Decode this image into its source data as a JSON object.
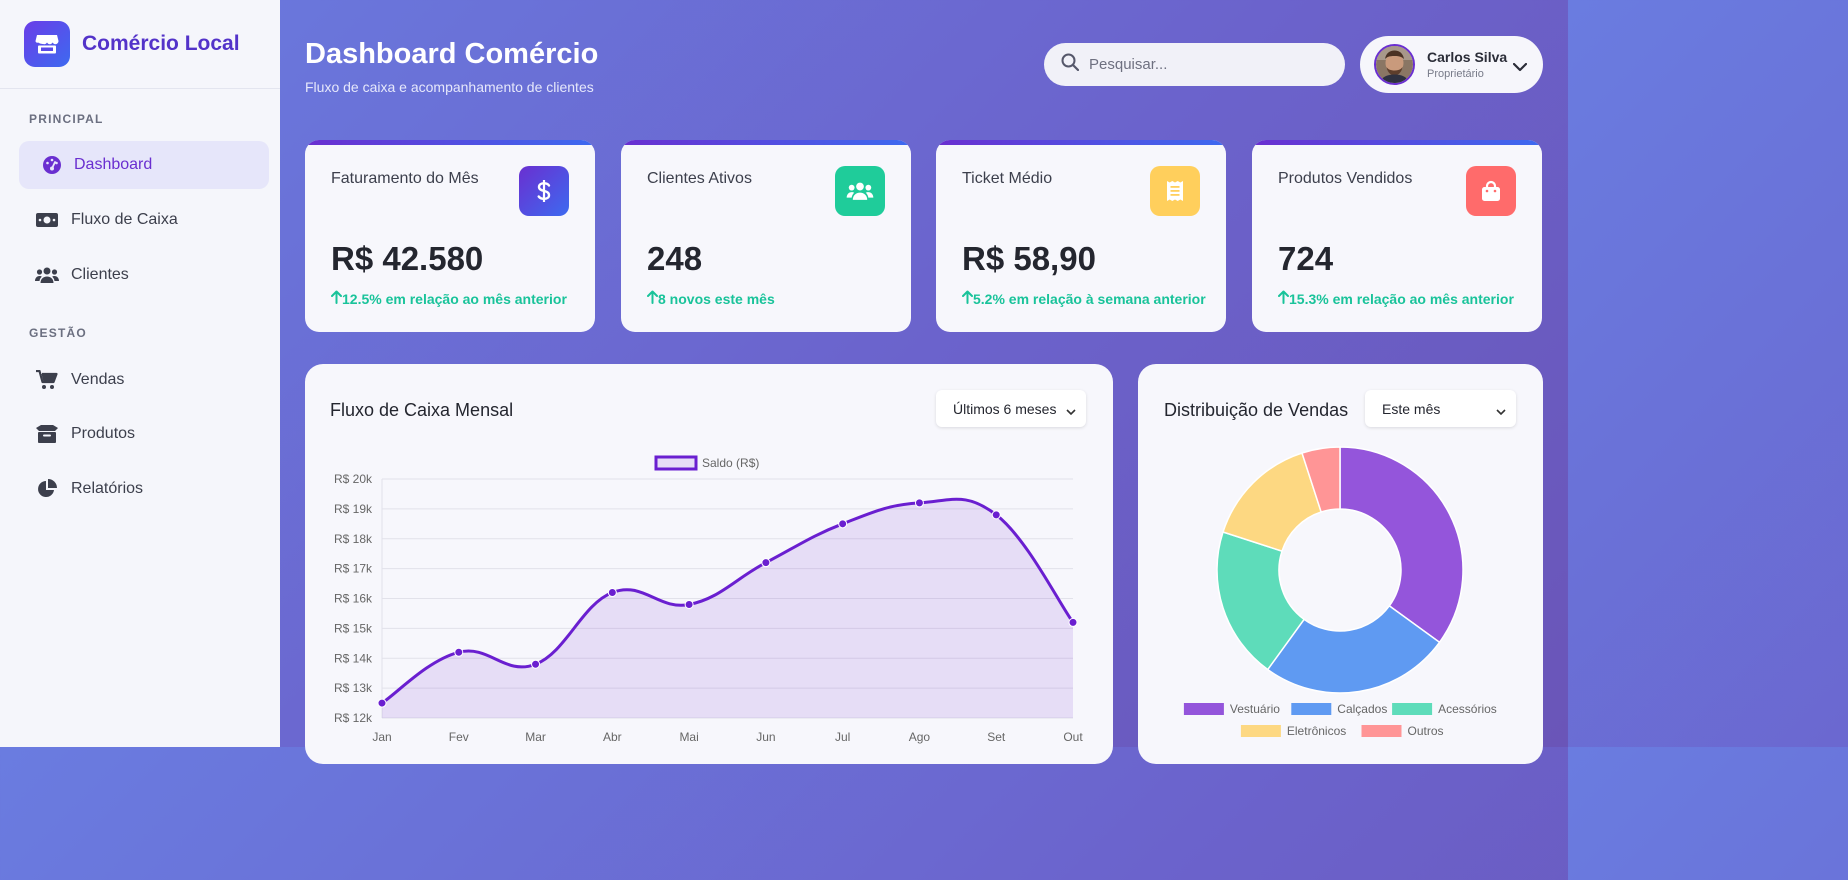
{
  "brand": {
    "name": "Comércio Local"
  },
  "sidebar": {
    "sections": [
      {
        "title": "PRINCIPAL"
      },
      {
        "title": "GESTÃO"
      }
    ],
    "items": [
      {
        "label": "Dashboard",
        "icon": "gauge-icon"
      },
      {
        "label": "Fluxo de Caixa",
        "icon": "money-bill-icon"
      },
      {
        "label": "Clientes",
        "icon": "users-icon"
      },
      {
        "label": "Vendas",
        "icon": "cart-icon"
      },
      {
        "label": "Produtos",
        "icon": "box-icon"
      },
      {
        "label": "Relatórios",
        "icon": "pie-chart-icon"
      }
    ]
  },
  "header": {
    "title": "Dashboard Comércio",
    "subtitle": "Fluxo de caixa e acompanhamento de clientes",
    "search_placeholder": "Pesquisar...",
    "user": {
      "name": "Carlos Silva",
      "role": "Proprietário"
    }
  },
  "cards": [
    {
      "label": "Faturamento do Mês",
      "value": "R$ 42.580",
      "change": "12.5% em relação ao mês anterior",
      "icon": "dollar-icon",
      "color": "#5b3de6"
    },
    {
      "label": "Clientes Ativos",
      "value": "248",
      "change": "8 novos este mês",
      "icon": "users-icon",
      "color": "#1fcc9a"
    },
    {
      "label": "Ticket Médio",
      "value": "R$ 58,90",
      "change": "5.2% em relação à semana anterior",
      "icon": "receipt-icon",
      "color": "#ffcf5c"
    },
    {
      "label": "Produtos Vendidos",
      "value": "724",
      "change": "15.3% em relação ao mês anterior",
      "icon": "shopping-bag-icon",
      "color": "#ff6b6b"
    }
  ],
  "cash_flow_panel": {
    "title": "Fluxo de Caixa Mensal",
    "period": "Últimos 6 meses"
  },
  "sales_panel": {
    "title": "Distribuição de Vendas",
    "period": "Este mês"
  },
  "chart_data": [
    {
      "type": "line",
      "title": "Fluxo de Caixa Mensal",
      "categories": [
        "Jan",
        "Fev",
        "Mar",
        "Abr",
        "Mai",
        "Jun",
        "Jul",
        "Ago",
        "Set",
        "Out"
      ],
      "series": [
        {
          "name": "Saldo (R$)",
          "values": [
            12500,
            14200,
            13800,
            16200,
            15800,
            17200,
            18500,
            19200,
            18800,
            15200
          ],
          "color": "#6a1fd0"
        }
      ],
      "ylim": [
        12000,
        20000
      ],
      "yticks": [
        "R$ 12k",
        "R$ 13k",
        "R$ 14k",
        "R$ 15k",
        "R$ 16k",
        "R$ 17k",
        "R$ 18k",
        "R$ 19k",
        "R$ 20k"
      ],
      "legend": "top",
      "fill": true,
      "grid": true
    },
    {
      "type": "pie",
      "title": "Distribuição de Vendas",
      "donut": true,
      "categories": [
        "Vestuário",
        "Calçados",
        "Acessórios",
        "Eletrônicos",
        "Outros"
      ],
      "values": [
        35,
        25,
        20,
        15,
        5
      ],
      "colors": [
        "#9455db",
        "#5f9af2",
        "#5edcba",
        "#fdd882",
        "#ff9596"
      ],
      "legend": "bottom"
    }
  ]
}
